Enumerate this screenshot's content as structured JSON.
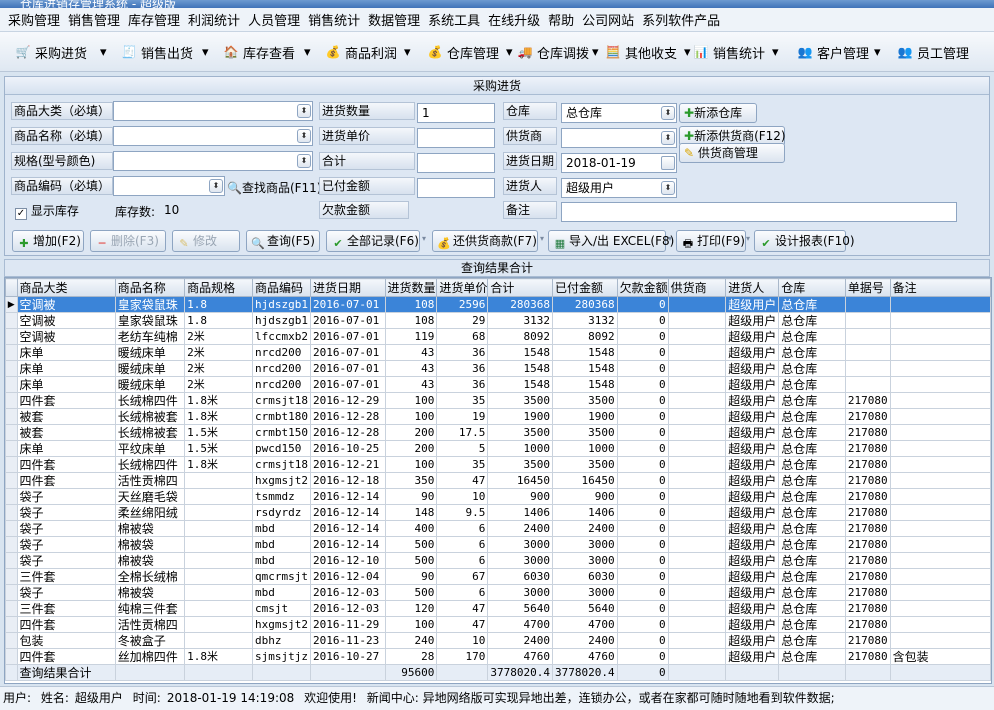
{
  "window": {
    "title": "仓库进销存管理系统 - 超级版"
  },
  "menu": [
    "采购管理",
    "销售管理",
    "库存管理",
    "利润统计",
    "人员管理",
    "销售统计",
    "数据管理",
    "系统工具",
    "在线升级",
    "帮助",
    "公司网站",
    "系列软件产品"
  ],
  "toolbar": {
    "purchase": "采购进货",
    "sales_out": "销售出货",
    "stock_view": "库存查看",
    "profit": "商品利润",
    "warehouse": "仓库管理",
    "transfer": "仓库调拨",
    "other_io": "其他收支",
    "sales_stat": "销售统计",
    "customers": "客户管理",
    "staff": "员工管理"
  },
  "form": {
    "panel_title": "采购进货",
    "category_label": "商品大类（必填）",
    "name_label": "商品名称（必填）",
    "spec_label": "规格(型号颜色)",
    "code_label": "商品编码（必填）",
    "find_product": "查找商品(F11)",
    "show_stock": "显示库存",
    "stock_count_label": "库存数:",
    "stock_count_value": "10",
    "qty_label": "进货数量",
    "qty_value": "1",
    "unit_price_label": "进货单价",
    "total_label": "合计",
    "paid_label": "已付金额",
    "debt_label": "欠款金额",
    "warehouse_label": "仓库",
    "warehouse_value": "总仓库",
    "add_warehouse": "新添仓库",
    "supplier_label": "供货商",
    "add_supplier": "新添供货商(F12)",
    "supplier_mgmt": "供货商管理",
    "date_label": "进货日期",
    "date_value": "2018-01-19",
    "buyer_label": "进货人",
    "buyer_value": "超级用户",
    "note_label": "备注"
  },
  "actions": {
    "add": "增加(F2)",
    "delete": "删除(F3)",
    "edit": "修改",
    "query": "查询(F5)",
    "all_records": "全部记录(F6)",
    "supplier_debt": "还供货商款(F7)",
    "excel": "导入/出 EXCEL(F8)",
    "print": "打印(F9)",
    "design_report": "设计报表(F10)"
  },
  "grid": {
    "title": "查询结果合计",
    "columns": [
      "商品大类",
      "商品名称",
      "商品规格",
      "商品编码",
      "进货日期",
      "进货数量",
      "进货单价",
      "合计",
      "已付金额",
      "欠款金额",
      "供货商",
      "进货人",
      "仓库",
      "单据号",
      "备注"
    ],
    "rows": [
      [
        "空调被",
        "皇家袋鼠珠",
        "1.8",
        "hjdszgb1",
        "2016-07-01",
        "108",
        "2596",
        "280368",
        "280368",
        "0",
        "",
        "超级用户",
        "总仓库",
        "",
        ""
      ],
      [
        "空调被",
        "皇家袋鼠珠",
        "1.8",
        "hjdszgb1",
        "2016-07-01",
        "108",
        "29",
        "3132",
        "3132",
        "0",
        "",
        "超级用户",
        "总仓库",
        "",
        ""
      ],
      [
        "空调被",
        "老纺车纯棉",
        "2米",
        "lfccmxb2",
        "2016-07-01",
        "119",
        "68",
        "8092",
        "8092",
        "0",
        "",
        "超级用户",
        "总仓库",
        "",
        ""
      ],
      [
        "床单",
        "暖绒床单",
        "2米",
        "nrcd200",
        "2016-07-01",
        "43",
        "36",
        "1548",
        "1548",
        "0",
        "",
        "超级用户",
        "总仓库",
        "",
        ""
      ],
      [
        "床单",
        "暖绒床单",
        "2米",
        "nrcd200",
        "2016-07-01",
        "43",
        "36",
        "1548",
        "1548",
        "0",
        "",
        "超级用户",
        "总仓库",
        "",
        ""
      ],
      [
        "床单",
        "暖绒床单",
        "2米",
        "nrcd200",
        "2016-07-01",
        "43",
        "36",
        "1548",
        "1548",
        "0",
        "",
        "超级用户",
        "总仓库",
        "",
        ""
      ],
      [
        "四件套",
        "长绒棉四件",
        "1.8米",
        "crmsjt18",
        "2016-12-29",
        "100",
        "35",
        "3500",
        "3500",
        "0",
        "",
        "超级用户",
        "总仓库",
        "217080",
        ""
      ],
      [
        "被套",
        "长绒棉被套",
        "1.8米",
        "crmbt180",
        "2016-12-28",
        "100",
        "19",
        "1900",
        "1900",
        "0",
        "",
        "超级用户",
        "总仓库",
        "217080",
        ""
      ],
      [
        "被套",
        "长绒棉被套",
        "1.5米",
        "crmbt150",
        "2016-12-28",
        "200",
        "17.5",
        "3500",
        "3500",
        "0",
        "",
        "超级用户",
        "总仓库",
        "217080",
        ""
      ],
      [
        "床单",
        "平纹床单",
        "1.5米",
        "pwcd150",
        "2016-10-25",
        "200",
        "5",
        "1000",
        "1000",
        "0",
        "",
        "超级用户",
        "总仓库",
        "217080",
        ""
      ],
      [
        "四件套",
        "长绒棉四件",
        "1.8米",
        "crmsjt18",
        "2016-12-21",
        "100",
        "35",
        "3500",
        "3500",
        "0",
        "",
        "超级用户",
        "总仓库",
        "217080",
        ""
      ],
      [
        "四件套",
        "活性贡棉四",
        "",
        "hxgmsjt2",
        "2016-12-18",
        "350",
        "47",
        "16450",
        "16450",
        "0",
        "",
        "超级用户",
        "总仓库",
        "217080",
        ""
      ],
      [
        "袋子",
        "天丝磨毛袋",
        "",
        "tsmmdz",
        "2016-12-14",
        "90",
        "10",
        "900",
        "900",
        "0",
        "",
        "超级用户",
        "总仓库",
        "217080",
        ""
      ],
      [
        "袋子",
        "柔丝绵阳绒",
        "",
        "rsdyrdz",
        "2016-12-14",
        "148",
        "9.5",
        "1406",
        "1406",
        "0",
        "",
        "超级用户",
        "总仓库",
        "217080",
        ""
      ],
      [
        "袋子",
        "棉被袋",
        "",
        "mbd",
        "2016-12-14",
        "400",
        "6",
        "2400",
        "2400",
        "0",
        "",
        "超级用户",
        "总仓库",
        "217080",
        ""
      ],
      [
        "袋子",
        "棉被袋",
        "",
        "mbd",
        "2016-12-14",
        "500",
        "6",
        "3000",
        "3000",
        "0",
        "",
        "超级用户",
        "总仓库",
        "217080",
        ""
      ],
      [
        "袋子",
        "棉被袋",
        "",
        "mbd",
        "2016-12-10",
        "500",
        "6",
        "3000",
        "3000",
        "0",
        "",
        "超级用户",
        "总仓库",
        "217080",
        ""
      ],
      [
        "三件套",
        "全棉长绒棉",
        "",
        "qmcrmsjt",
        "2016-12-04",
        "90",
        "67",
        "6030",
        "6030",
        "0",
        "",
        "超级用户",
        "总仓库",
        "217080",
        ""
      ],
      [
        "袋子",
        "棉被袋",
        "",
        "mbd",
        "2016-12-03",
        "500",
        "6",
        "3000",
        "3000",
        "0",
        "",
        "超级用户",
        "总仓库",
        "217080",
        ""
      ],
      [
        "三件套",
        "纯棉三件套",
        "",
        "cmsjt",
        "2016-12-03",
        "120",
        "47",
        "5640",
        "5640",
        "0",
        "",
        "超级用户",
        "总仓库",
        "217080",
        ""
      ],
      [
        "四件套",
        "活性贡棉四",
        "",
        "hxgmsjt2",
        "2016-11-29",
        "100",
        "47",
        "4700",
        "4700",
        "0",
        "",
        "超级用户",
        "总仓库",
        "217080",
        ""
      ],
      [
        "包装",
        "冬被盒子",
        "",
        "dbhz",
        "2016-11-23",
        "240",
        "10",
        "2400",
        "2400",
        "0",
        "",
        "超级用户",
        "总仓库",
        "217080",
        ""
      ],
      [
        "四件套",
        "丝加棉四件",
        "1.8米",
        "sjmsjtjz",
        "2016-10-27",
        "28",
        "170",
        "4760",
        "4760",
        "0",
        "",
        "超级用户",
        "总仓库",
        "217080",
        "含包装"
      ]
    ],
    "summary": [
      "查询结果合计",
      "",
      "",
      "",
      "",
      "95600",
      "",
      "3778020.4",
      "3778020.4",
      "0",
      "",
      "",
      "",
      "",
      ""
    ]
  },
  "status": {
    "user_prefix": "用户:",
    "name_label": "姓名:",
    "name_value": "超级用户",
    "time_label": "时间:",
    "time_value": "2018-01-19 14:19:08",
    "welcome": "欢迎使用!",
    "news": "新闻中心: 异地网络版可实现异地出差，连锁办公，或者在家都可随时随地看到软件数据;"
  },
  "colors": {
    "selected_row": "#3b84d8",
    "panel_bg": "#dde7f3",
    "title_bar": "#3f73b8"
  }
}
